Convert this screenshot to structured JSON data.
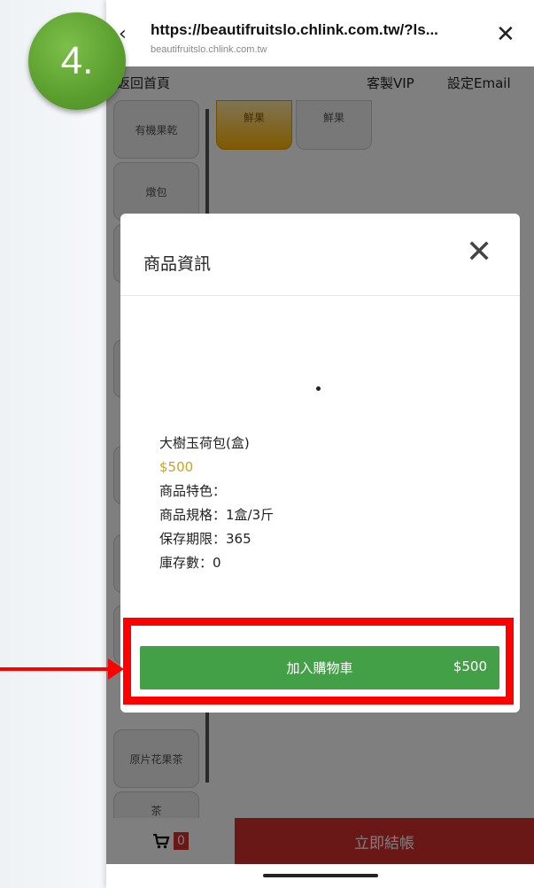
{
  "browser": {
    "url": "https://beautifruitslo.chlink.com.tw/?ls...",
    "domain": "beautifruitslo.chlink.com.tw",
    "back_icon": "back-arrow-icon",
    "close_icon": "close-icon"
  },
  "nav": {
    "home": "返回首頁",
    "vip": "客製VIP",
    "email": "設定Email"
  },
  "categories": [
    "有機果乾",
    "燉包",
    "原片花果茶",
    "茶"
  ],
  "tabs": [
    "鮮果",
    "鮮果"
  ],
  "modal": {
    "title": "商品資訊",
    "product_name": "大樹玉荷包(盒)",
    "price": "$500",
    "features": "商品特色：",
    "spec": "商品規格：1盒/3斤",
    "shelf_life": "保存期限：365",
    "stock": "庫存數：0",
    "add_to_cart": "加入購物車",
    "add_to_cart_price": "$500"
  },
  "bottom": {
    "cart_count": "0",
    "checkout": "立即結帳"
  },
  "annotation": {
    "step": "4."
  },
  "colors": {
    "accent_green": "#43a047",
    "checkout_red": "#d32f2f",
    "highlight_red": "#ff0000",
    "price_gold": "#c9a227",
    "badge_green": "#5a9e2e"
  }
}
